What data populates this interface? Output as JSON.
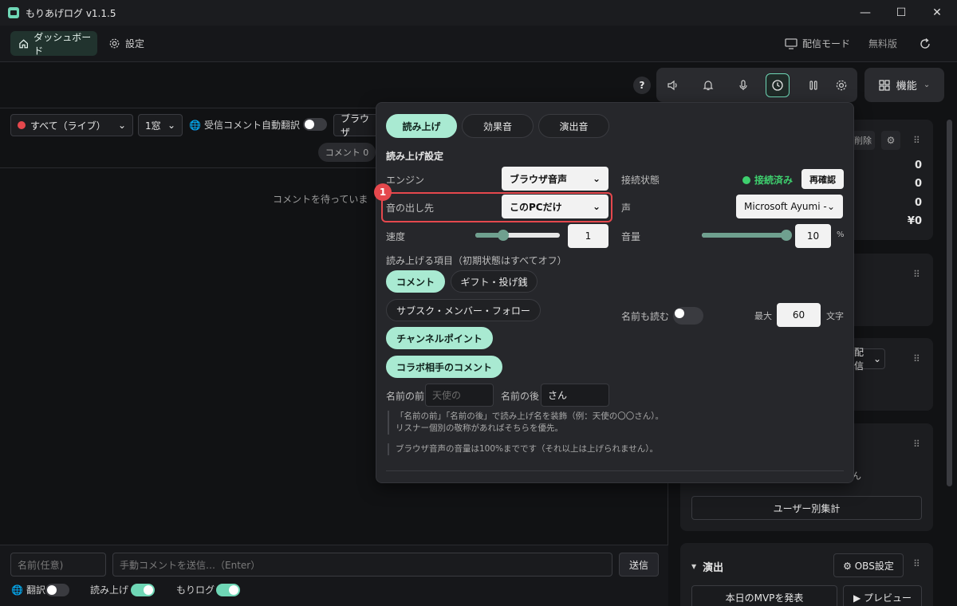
{
  "window": {
    "title": "もりあげログ v1.1.5",
    "minimize": "—",
    "maximize": "☐",
    "close": "✕"
  },
  "nav": {
    "dashboard": "ダッシュボード",
    "settings": "設定",
    "stream_mode": "配信モード",
    "free_edition": "無料版"
  },
  "toolbar": {
    "help": "?",
    "features": "機能"
  },
  "filters": {
    "source": "すべて（ライブ）",
    "windows": "1窓",
    "auto_translate": "受信コメント自動翻訳",
    "browser_partial": "ブラウザ",
    "comment_count": "コメント 0"
  },
  "comments": {
    "waiting": "コメントを待っていま"
  },
  "bottom": {
    "name_placeholder": "名前(任意)",
    "comment_placeholder": "手動コメントを送信…（Enter）",
    "send": "送信",
    "translate": "翻訳",
    "read_aloud": "読み上げ",
    "morilog": "もりログ"
  },
  "popup": {
    "tabs": [
      "読み上げ",
      "効果音",
      "演出音"
    ],
    "section_title": "読み上げ設定",
    "engine_label": "エンジン",
    "engine_value": "ブラウザ音声",
    "output_label": "音の出し先",
    "output_value": "このPCだけ",
    "speed_label": "速度",
    "speed_value": "1",
    "speed_fraction": 0.33,
    "items_label": "読み上げる項目（初期状態はすべてオフ）",
    "chips": {
      "comment": "コメント",
      "gift": "ギフト・投げ銭",
      "subscribe": "サブスク・メンバー・フォロー",
      "channel_points": "チャンネルポイント",
      "collab": "コラボ相手のコメント"
    },
    "connection_label": "接続状態",
    "connection_status": "接続済み",
    "recheck": "再確認",
    "voice_label": "声",
    "voice_value": "Microsoft Ayumi -",
    "volume_label": "音量",
    "volume_value": "10",
    "volume_fraction": 1.0,
    "volume_unit": "%",
    "read_names_label": "名前も読む",
    "max_label": "最大",
    "max_value": "60",
    "chars_unit": "文字",
    "name_before_label": "名前の前",
    "name_before_placeholder": "天使の",
    "name_after_label": "名前の後",
    "name_after_value": "さん",
    "note1_line1": "「名前の前」「名前の後」で読み上げ名を装飾（例：天使の〇〇さん）。",
    "note1_line2": "リスナー個別の敬称があればそちらを優先。",
    "note2": "ブラウザ音声の音量は100%までです（それ以上は上げられません）。",
    "badge": "1"
  },
  "sidebar": {
    "delete_partial": "削除",
    "stats": [
      "0",
      "0",
      "0",
      "¥0"
    ],
    "stream_partial": "配信",
    "san_partial": "ん",
    "user_stats": "ユーザー別集計",
    "effects_title": "演出",
    "obs_settings": "⚙ OBS設定",
    "announce_mvp": "本日のMVPを発表",
    "preview": "▶ プレビュー"
  },
  "colors": {
    "accent": "#6fd7b6",
    "chip": "#a9ead2",
    "alert": "#e5484d",
    "connected": "#3ecf6e"
  }
}
